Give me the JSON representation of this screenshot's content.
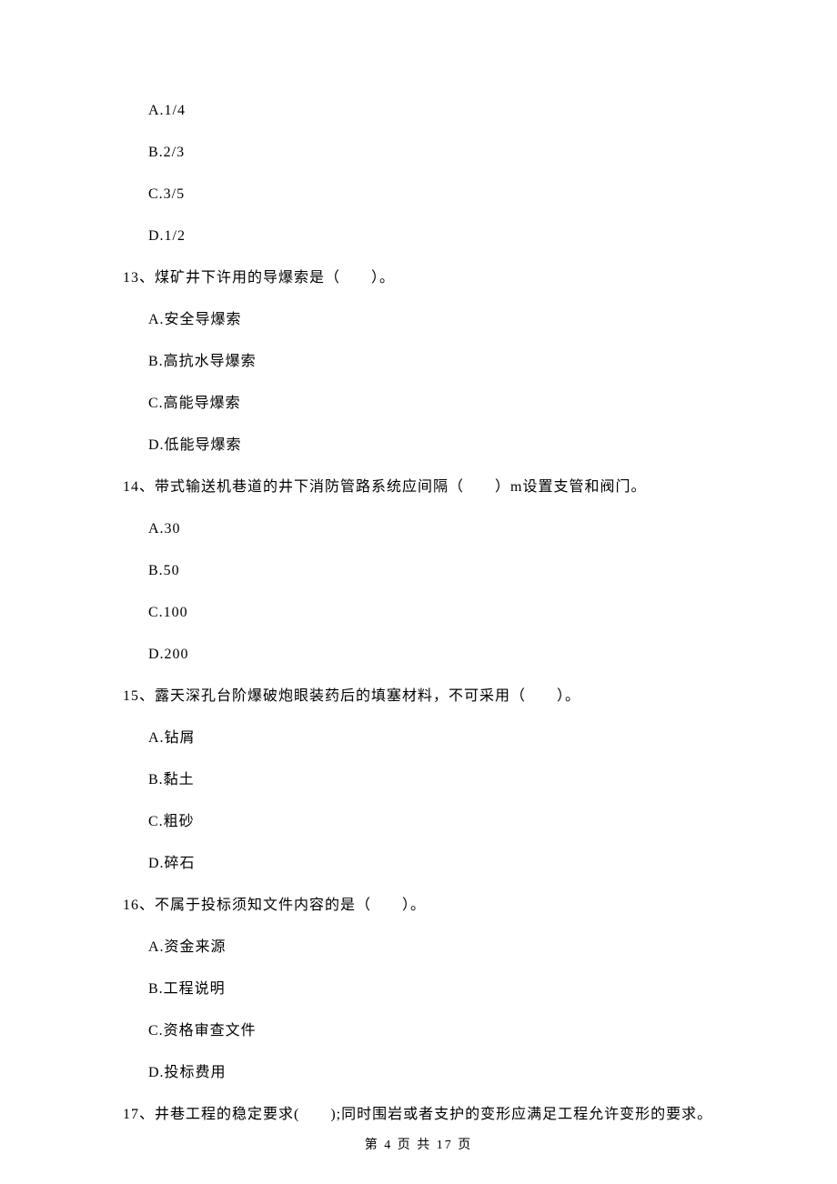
{
  "q12_options": {
    "a": "A.1/4",
    "b": "B.2/3",
    "c": "C.3/5",
    "d": "D.1/2"
  },
  "q13": {
    "stem": "13、煤矿井下许用的导爆索是（　　）。",
    "a": "A.安全导爆索",
    "b": "B.高抗水导爆索",
    "c": "C.高能导爆索",
    "d": "D.低能导爆索"
  },
  "q14": {
    "stem": "14、带式输送机巷道的井下消防管路系统应间隔（　　）m设置支管和阀门。",
    "a": "A.30",
    "b": "B.50",
    "c": "C.100",
    "d": "D.200"
  },
  "q15": {
    "stem": "15、露天深孔台阶爆破炮眼装药后的填塞材料，不可采用（　　）。",
    "a": "A.钻屑",
    "b": "B.黏土",
    "c": "C.粗砂",
    "d": "D.碎石"
  },
  "q16": {
    "stem": "16、不属于投标须知文件内容的是（　　）。",
    "a": "A.资金来源",
    "b": "B.工程说明",
    "c": "C.资格审查文件",
    "d": "D.投标费用"
  },
  "q17": {
    "stem": "17、井巷工程的稳定要求(　　);同时围岩或者支护的变形应满足工程允许变形的要求。"
  },
  "footer": "第 4 页 共 17 页"
}
